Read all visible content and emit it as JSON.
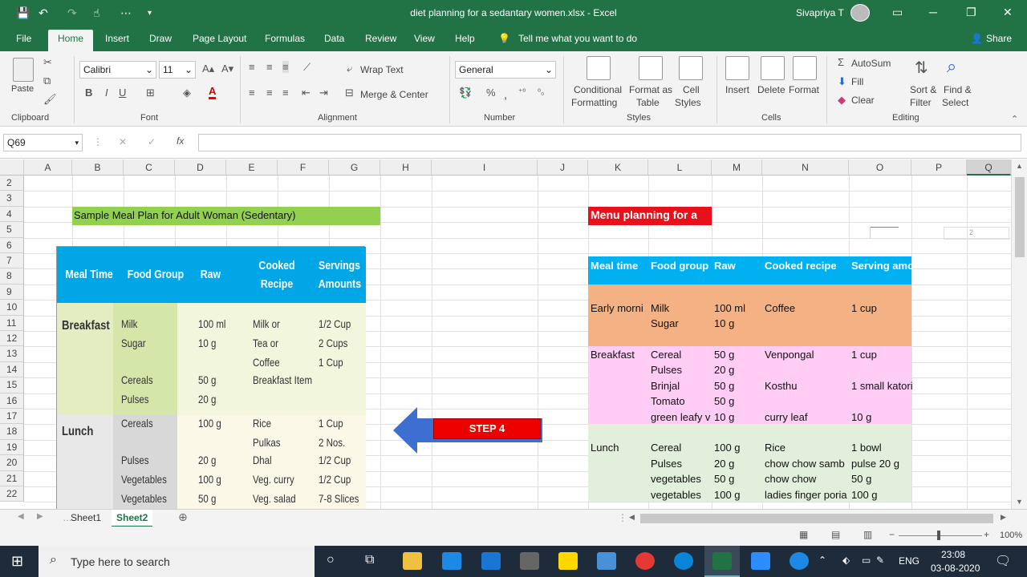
{
  "window": {
    "title": "diet planning for a sedantary women.xlsx  -  Excel",
    "user": "Sivapriya T"
  },
  "menu": [
    "File",
    "Home",
    "Insert",
    "Draw",
    "Page Layout",
    "Formulas",
    "Data",
    "Review",
    "View",
    "Help"
  ],
  "tell_me": "Tell me what you want to do",
  "share": "Share",
  "ribbon": {
    "paste": "Paste",
    "clipboard": "Clipboard",
    "font_name": "Calibri",
    "font_size": "11",
    "font_group": "Font",
    "wrap_text": "Wrap Text",
    "merge_center": "Merge & Center",
    "alignment": "Alignment",
    "number_format": "General",
    "number_group": "Number",
    "cond_format_1": "Conditional",
    "cond_format_2": "Formatting",
    "format_table_1": "Format as",
    "format_table_2": "Table",
    "cell_styles_1": "Cell",
    "cell_styles_2": "Styles",
    "styles_group": "Styles",
    "insert": "Insert",
    "delete": "Delete",
    "format": "Format",
    "cells_group": "Cells",
    "autosum": "AutoSum",
    "fill": "Fill",
    "clear": "Clear",
    "sort_1": "Sort &",
    "sort_2": "Filter",
    "find_1": "Find &",
    "find_2": "Select",
    "editing_group": "Editing"
  },
  "formula_bar": {
    "name_box": "Q69",
    "fx": "fx"
  },
  "columns": [
    "A",
    "B",
    "C",
    "D",
    "E",
    "F",
    "G",
    "H",
    "I",
    "J",
    "K",
    "L",
    "M",
    "N",
    "O",
    "P",
    "Q"
  ],
  "rows": [
    "2",
    "3",
    "4",
    "5",
    "6",
    "7",
    "8",
    "9",
    "10",
    "11",
    "12",
    "13",
    "14",
    "15",
    "16",
    "17",
    "18",
    "19",
    "20",
    "21",
    "22"
  ],
  "sheet": {
    "b4_title": "Sample Meal Plan for Adult Woman (Sedentary)",
    "k4_title": "Menu planning for a",
    "step_label": "STEP 4",
    "table_headers": [
      "Meal time",
      "Food group",
      "Raw",
      "Cooked recipe",
      "Serving amo"
    ],
    "table_rows": [
      {
        "k": "Early morni",
        "l": "Milk",
        "m": "100 ml",
        "n": "Coffee",
        "o": "1 cup"
      },
      {
        "k": "",
        "l": "Sugar",
        "m": "10 g",
        "n": "",
        "o": ""
      },
      {
        "k": "",
        "l": "",
        "m": "",
        "n": "",
        "o": ""
      },
      {
        "k": "Breakfast",
        "l": "Cereal",
        "m": "50 g",
        "n": "Venpongal",
        "o": "1 cup"
      },
      {
        "k": "",
        "l": "Pulses",
        "m": "20 g",
        "n": "",
        "o": ""
      },
      {
        "k": "",
        "l": "Brinjal",
        "m": "50 g",
        "n": "Kosthu",
        "o": "1 small katori"
      },
      {
        "k": "",
        "l": "Tomato",
        "m": "50 g",
        "n": "",
        "o": ""
      },
      {
        "k": "",
        "l": "green leafy v",
        "m": "10 g",
        "n": "curry leaf",
        "o": "10 g"
      },
      {
        "k": "",
        "l": "",
        "m": "",
        "n": "",
        "o": ""
      },
      {
        "k": "Lunch",
        "l": "Cereal",
        "m": "100 g",
        "n": "Rice",
        "o": "1 bowl"
      },
      {
        "k": "",
        "l": "Pulses",
        "m": "20 g",
        "n": "chow chow samb",
        "o": "pulse 20 g"
      },
      {
        "k": "",
        "l": "vegetables",
        "m": "50 g",
        "n": "chow chow",
        "o": "50 g"
      },
      {
        "k": "",
        "l": "vegetables",
        "m": "100 g",
        "n": "ladies finger poria",
        "o": "100 g"
      }
    ]
  },
  "meal_image": {
    "headers": [
      "Meal Time",
      "Food Group",
      "Raw",
      "Cooked Recipe",
      "Servings Amounts"
    ],
    "breakfast": "Breakfast",
    "lunch": "Lunch",
    "rows": [
      {
        "group": "Milk",
        "raw": "100 ml",
        "recipe": "Milk or",
        "amount": "1/2 Cup"
      },
      {
        "group": "Sugar",
        "raw": "10 g",
        "recipe": "Tea or",
        "amount": "2 Cups"
      },
      {
        "group": "",
        "raw": "",
        "recipe": "Coffee",
        "amount": "1 Cup"
      },
      {
        "group": "Cereals",
        "raw": "50 g",
        "recipe": "Breakfast Item",
        "amount": ""
      },
      {
        "group": "Pulses",
        "raw": "20 g",
        "recipe": "",
        "amount": ""
      },
      {
        "group": "Cereals",
        "raw": "100 g",
        "recipe": "Rice",
        "amount": "1 Cup"
      },
      {
        "group": "",
        "raw": "",
        "recipe": "Pulkas",
        "amount": "2 Nos."
      },
      {
        "group": "Pulses",
        "raw": "20 g",
        "recipe": "Dhal",
        "amount": "1/2 Cup"
      },
      {
        "group": "Vegetables",
        "raw": "100 g",
        "recipe": "Veg. curry",
        "amount": "1/2 Cup"
      },
      {
        "group": "Vegetables",
        "raw": "50 g",
        "recipe": "Veg. salad",
        "amount": "7-8 Slices"
      }
    ]
  },
  "sheet_tabs": [
    "Sheet1",
    "Sheet2"
  ],
  "status": {
    "zoom": "100%"
  },
  "taskbar": {
    "search": "Type here to search",
    "time": "23:08",
    "date": "03-08-2020",
    "lang": "ENG"
  },
  "colors": {
    "excel_green": "#217346",
    "red_header": "#e8101a",
    "blue_header": "#00b0f0",
    "orange_rows": "#f4b183",
    "pink_rows": "#ffccf5",
    "green_rows": "#e2efda",
    "title_green": "#92d050"
  }
}
